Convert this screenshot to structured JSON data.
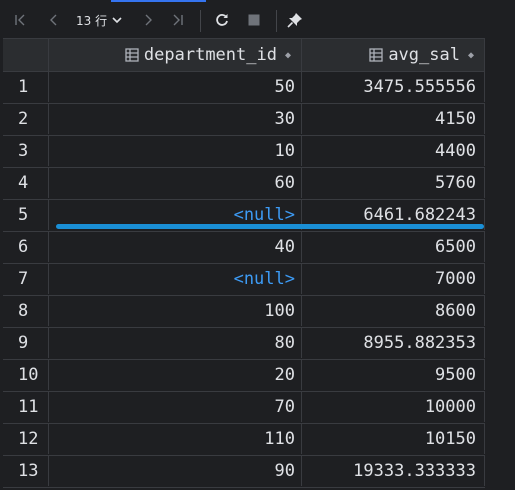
{
  "toolbar": {
    "rows_count": "13 行",
    "buttons": [
      "first-page",
      "prev-page",
      "next-page",
      "last-page",
      "refresh",
      "stop",
      "pin"
    ]
  },
  "columns": [
    {
      "name": "department_id"
    },
    {
      "name": "avg_sal"
    }
  ],
  "rows": [
    {
      "idx": "1",
      "department_id": "50",
      "avg_sal": "3475.555556",
      "dept_null": false
    },
    {
      "idx": "2",
      "department_id": "30",
      "avg_sal": "4150",
      "dept_null": false
    },
    {
      "idx": "3",
      "department_id": "10",
      "avg_sal": "4400",
      "dept_null": false
    },
    {
      "idx": "4",
      "department_id": "60",
      "avg_sal": "5760",
      "dept_null": false
    },
    {
      "idx": "5",
      "department_id": "<null>",
      "avg_sal": "6461.682243",
      "dept_null": true
    },
    {
      "idx": "6",
      "department_id": "40",
      "avg_sal": "6500",
      "dept_null": false
    },
    {
      "idx": "7",
      "department_id": "<null>",
      "avg_sal": "7000",
      "dept_null": true
    },
    {
      "idx": "8",
      "department_id": "100",
      "avg_sal": "8600",
      "dept_null": false
    },
    {
      "idx": "9",
      "department_id": "80",
      "avg_sal": "8955.882353",
      "dept_null": false
    },
    {
      "idx": "10",
      "department_id": "20",
      "avg_sal": "9500",
      "dept_null": false
    },
    {
      "idx": "11",
      "department_id": "70",
      "avg_sal": "10000",
      "dept_null": false
    },
    {
      "idx": "12",
      "department_id": "110",
      "avg_sal": "10150",
      "dept_null": false
    },
    {
      "idx": "13",
      "department_id": "90",
      "avg_sal": "19333.333333",
      "dept_null": false
    }
  ],
  "colors": {
    "background": "#1e1f22",
    "header": "#2b2d30",
    "null_text": "#3d9bf5",
    "highlight_line": "#1a8fd6"
  }
}
